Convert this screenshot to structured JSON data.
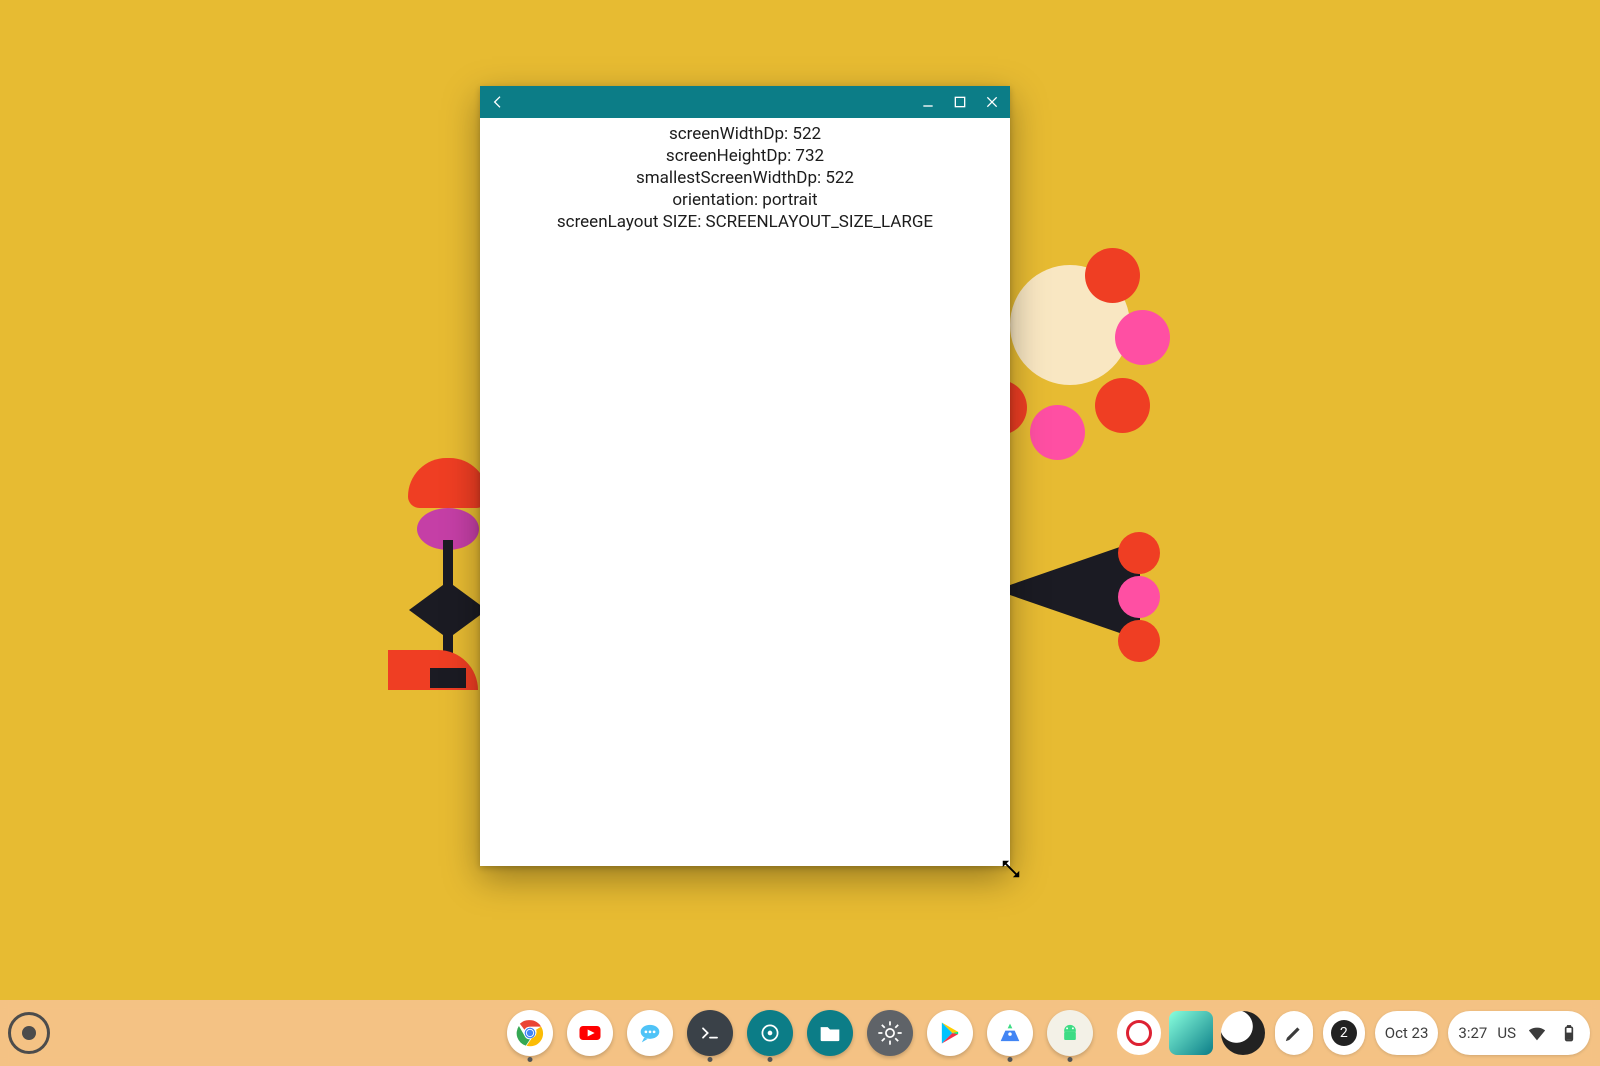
{
  "window": {
    "metrics": {
      "screenWidthDp": "screenWidthDp: 522",
      "screenHeightDp": "screenHeightDp: 732",
      "smallestScreenWidthDp": "smallestScreenWidthDp: 522",
      "orientation": "orientation: portrait",
      "screenLayoutSize": "screenLayout SIZE: SCREENLAYOUT_SIZE_LARGE"
    }
  },
  "status": {
    "notification_count": "2",
    "date": "Oct 23",
    "time": "3:27",
    "keyboard": "US"
  }
}
